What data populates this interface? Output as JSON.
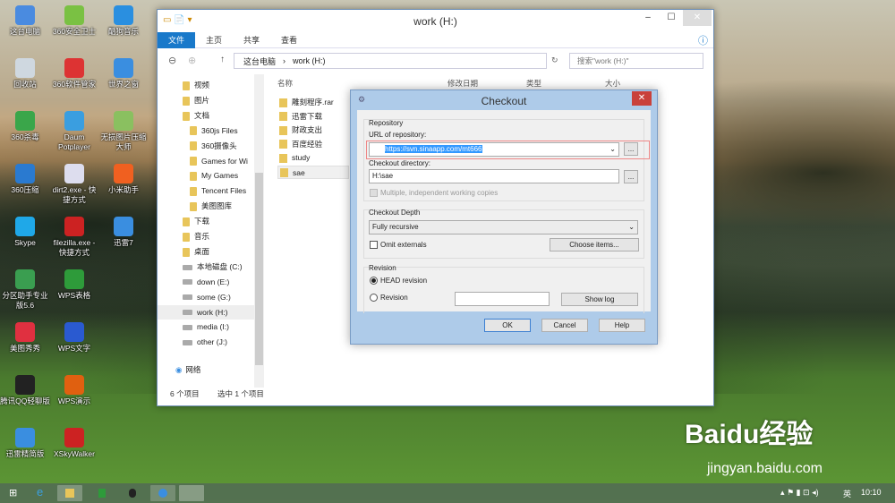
{
  "desktop_icons": [
    {
      "label": "这台电脑",
      "color": "#4a8be0"
    },
    {
      "label": "360安全卫士",
      "color": "#7ac143"
    },
    {
      "label": "酷狗音乐",
      "color": "#2a8fe0"
    },
    {
      "label": "回收站",
      "color": "#cfd8e0"
    },
    {
      "label": "360软件管家",
      "color": "#d33"
    },
    {
      "label": "世界之窗",
      "color": "#3a8ee0"
    },
    {
      "label": "360杀毒",
      "color": "#3aa64a"
    },
    {
      "label": "Daum Potplayer",
      "color": "#3a9ee0"
    },
    {
      "label": "无损图片压缩大师",
      "color": "#8ac060"
    },
    {
      "label": "360压缩",
      "color": "#2a7ad0"
    },
    {
      "label": "dirt2.exe - 快捷方式",
      "color": "#dde"
    },
    {
      "label": "小米助手",
      "color": "#f06020"
    },
    {
      "label": "Skype",
      "color": "#1fa8e8"
    },
    {
      "label": "filezilla.exe - 快捷方式",
      "color": "#c22"
    },
    {
      "label": "迅雷7",
      "color": "#3a8ee0"
    },
    {
      "label": "分区助手专业版5.6",
      "color": "#3a9e50"
    },
    {
      "label": "WPS表格",
      "color": "#2e9b3a"
    },
    null,
    {
      "label": "美图秀秀",
      "color": "#e03040"
    },
    {
      "label": "WPS文字",
      "color": "#2a5ad0"
    },
    null,
    {
      "label": "腾讯QQ轻聊版",
      "color": "#222"
    },
    {
      "label": "WPS演示",
      "color": "#e06010"
    },
    null,
    {
      "label": "迅雷精简版",
      "color": "#3a8ee0"
    },
    {
      "label": "XSkyWalker",
      "color": "#c22"
    },
    null
  ],
  "explorer": {
    "title": "work (H:)",
    "tabs": [
      "文件",
      "主页",
      "共享",
      "查看"
    ],
    "breadcrumb": [
      "这台电脑",
      "work (H:)"
    ],
    "search_placeholder": "搜索\"work (H:)\"",
    "columns": [
      "名称",
      "修改日期",
      "类型",
      "大小"
    ],
    "nav": [
      {
        "label": "视频",
        "type": "folder",
        "indent": 0
      },
      {
        "label": "图片",
        "type": "folder",
        "indent": 0
      },
      {
        "label": "文档",
        "type": "folder",
        "indent": 0
      },
      {
        "label": "360js Files",
        "type": "folder",
        "indent": 1
      },
      {
        "label": "360摄像头",
        "type": "folder",
        "indent": 1
      },
      {
        "label": "Games for Wi",
        "type": "folder",
        "indent": 1
      },
      {
        "label": "My Games",
        "type": "folder",
        "indent": 1
      },
      {
        "label": "Tencent Files",
        "type": "folder",
        "indent": 1
      },
      {
        "label": "美图图库",
        "type": "folder",
        "indent": 1
      },
      {
        "label": "下载",
        "type": "folder",
        "indent": 0
      },
      {
        "label": "音乐",
        "type": "folder",
        "indent": 0
      },
      {
        "label": "桌面",
        "type": "folder",
        "indent": 0
      },
      {
        "label": "本地磁盘 (C:)",
        "type": "drive",
        "indent": 0
      },
      {
        "label": "down (E:)",
        "type": "drive",
        "indent": 0
      },
      {
        "label": "some (G:)",
        "type": "drive",
        "indent": 0
      },
      {
        "label": "work (H:)",
        "type": "drive",
        "indent": 0,
        "selected": true
      },
      {
        "label": "media (I:)",
        "type": "drive",
        "indent": 0
      },
      {
        "label": "other (J:)",
        "type": "drive",
        "indent": 0
      }
    ],
    "network": "网络",
    "files": [
      {
        "name": "雕刻程序.rar"
      },
      {
        "name": "迅雷下载"
      },
      {
        "name": "财政支出"
      },
      {
        "name": "百度经验"
      },
      {
        "name": "study"
      },
      {
        "name": "sae",
        "selected": true
      }
    ],
    "status_count": "6 个项目",
    "status_selected": "选中 1 个项目"
  },
  "dialog": {
    "title": "Checkout",
    "repository_group": "Repository",
    "url_label": "URL of repository:",
    "url_value": "https://svn.sinaapp.com/mt666",
    "dir_label": "Checkout directory:",
    "dir_value": "H:\\sae",
    "browse": "...",
    "multiple": "Multiple, independent working copies",
    "depth_group": "Checkout Depth",
    "depth_value": "Fully recursive",
    "omit_externals": "Omit externals",
    "choose_items": "Choose items...",
    "revision_group": "Revision",
    "head_revision": "HEAD revision",
    "revision": "Revision",
    "show_log": "Show log",
    "ok": "OK",
    "cancel": "Cancel",
    "help": "Help"
  },
  "taskbar": {
    "ime": "英",
    "time": "10:10"
  },
  "watermark": {
    "logo": "Baidu经验",
    "url": "jingyan.baidu.com"
  }
}
